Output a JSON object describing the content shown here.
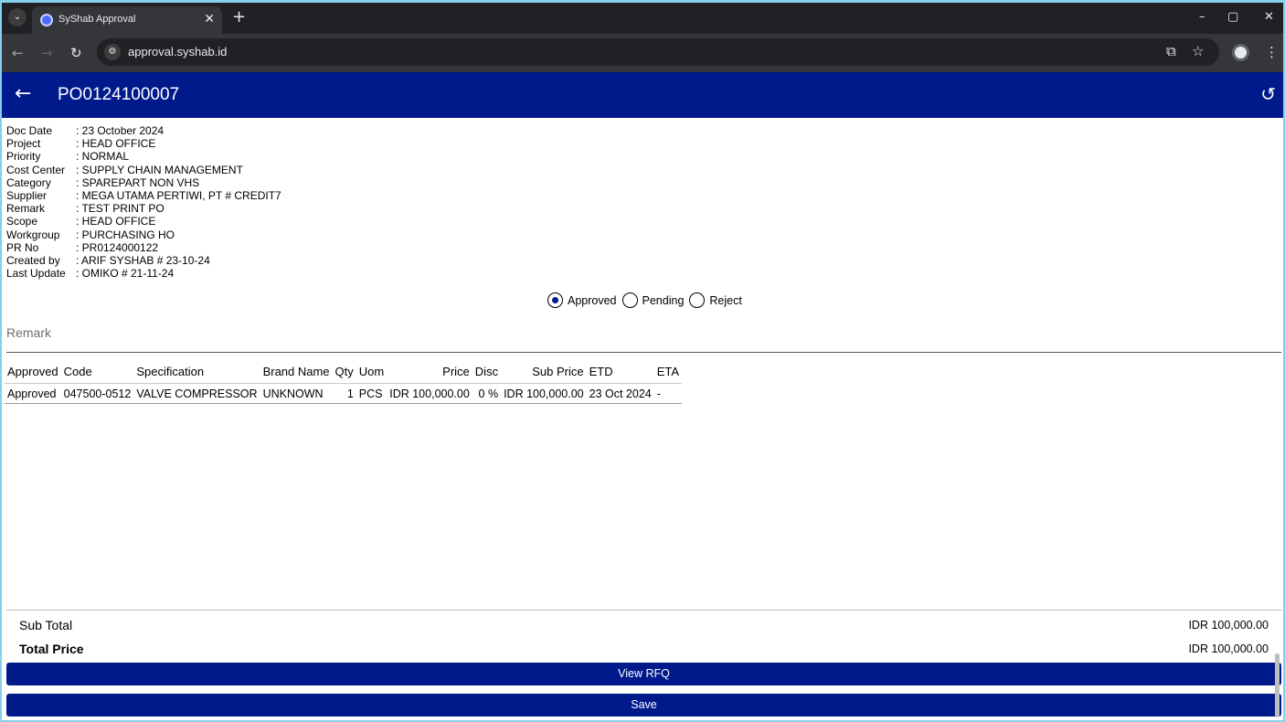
{
  "browser": {
    "tab_title": "SyShab Approval",
    "url": "approval.syshab.id",
    "tab_menu_icon": "chevron-down-icon"
  },
  "header": {
    "title": "PO0124100007",
    "back_icon": "arrow-left-icon",
    "history_icon": "history-icon"
  },
  "info": [
    {
      "label": "Doc Date",
      "value": ": 23 October 2024"
    },
    {
      "label": "Project",
      "value": ": HEAD OFFICE"
    },
    {
      "label": "Priority",
      "value": ": NORMAL"
    },
    {
      "label": "Cost Center",
      "value": ": SUPPLY CHAIN MANAGEMENT"
    },
    {
      "label": "Category",
      "value": ": SPAREPART NON VHS"
    },
    {
      "label": "Supplier",
      "value": ": MEGA UTAMA PERTIWI, PT # CREDIT7"
    },
    {
      "label": "Remark",
      "value": ": TEST PRINT PO"
    },
    {
      "label": "Scope",
      "value": ": HEAD OFFICE"
    },
    {
      "label": "Workgroup",
      "value": ": PURCHASING HO"
    },
    {
      "label": "PR No",
      "value": ": PR0124000122"
    },
    {
      "label": "Created by",
      "value": ": ARIF SYSHAB # 23-10-24"
    },
    {
      "label": "Last Update",
      "value": ": OMIKO # 21-11-24"
    }
  ],
  "approval": {
    "options": [
      "Approved",
      "Pending",
      "Reject"
    ],
    "selected": "Approved"
  },
  "remark": {
    "placeholder": "Remark",
    "value": ""
  },
  "table": {
    "headers": [
      "Approved",
      "Code",
      "Specification",
      "Brand Name",
      "Qty",
      "Uom",
      "Price",
      "Disc",
      "Sub Price",
      "ETD",
      "ETA"
    ],
    "rows": [
      [
        "Approved",
        "047500-0512",
        "VALVE COMPRESSOR",
        "UNKNOWN",
        "1",
        "PCS",
        "IDR 100,000.00",
        "0 %",
        "IDR 100,000.00",
        "23 Oct 2024",
        "-"
      ]
    ]
  },
  "totals": {
    "sub_total_label": "Sub Total",
    "sub_total_value": "IDR 100,000.00",
    "total_label": "Total Price",
    "total_value": "IDR 100,000.00"
  },
  "buttons": {
    "view_rfq": "View RFQ",
    "save": "Save"
  },
  "colors": {
    "brand": "#001a8c"
  }
}
